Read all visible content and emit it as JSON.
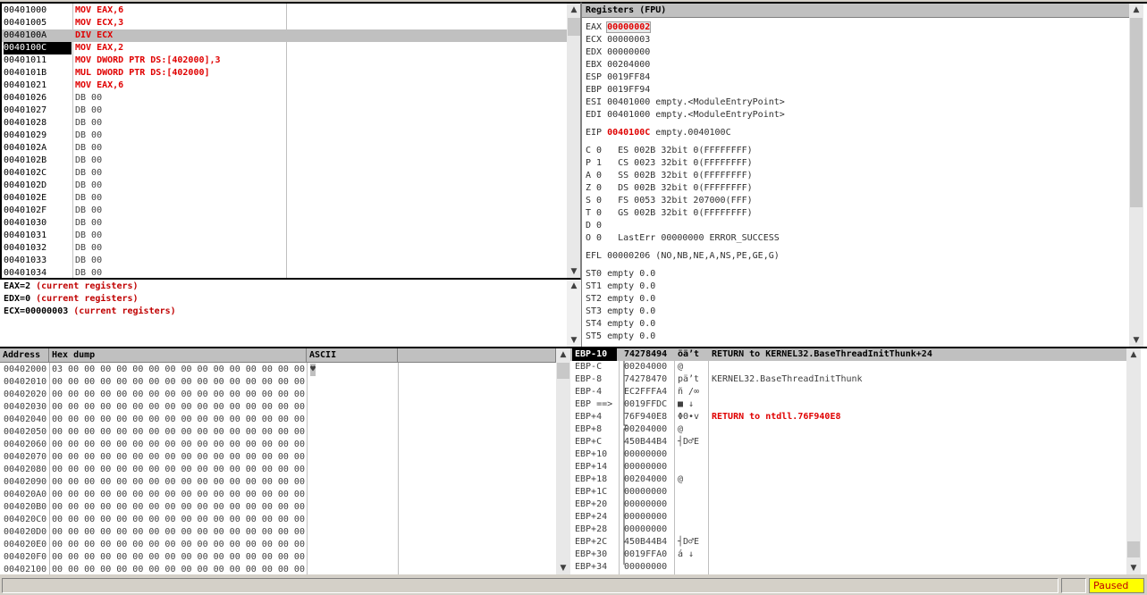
{
  "disassembly": {
    "rows": [
      {
        "addr": "00401000",
        "instr": "MOV EAX,6",
        "style": "red"
      },
      {
        "addr": "00401005",
        "instr": "MOV ECX,3",
        "style": "red"
      },
      {
        "addr": "0040100A",
        "instr": "DIV ECX",
        "style": "red",
        "state": "sel"
      },
      {
        "addr": "0040100C",
        "instr": "MOV EAX,2",
        "style": "red",
        "state": "cur"
      },
      {
        "addr": "00401011",
        "instr": "MOV DWORD PTR DS:[402000],3",
        "style": "red"
      },
      {
        "addr": "0040101B",
        "instr": "MUL DWORD PTR DS:[402000]",
        "style": "red"
      },
      {
        "addr": "00401021",
        "instr": "MOV EAX,6",
        "style": "red"
      },
      {
        "addr": "00401026",
        "instr": "DB 00",
        "style": "gray"
      },
      {
        "addr": "00401027",
        "instr": "DB 00",
        "style": "gray"
      },
      {
        "addr": "00401028",
        "instr": "DB 00",
        "style": "gray"
      },
      {
        "addr": "00401029",
        "instr": "DB 00",
        "style": "gray"
      },
      {
        "addr": "0040102A",
        "instr": "DB 00",
        "style": "gray"
      },
      {
        "addr": "0040102B",
        "instr": "DB 00",
        "style": "gray"
      },
      {
        "addr": "0040102C",
        "instr": "DB 00",
        "style": "gray"
      },
      {
        "addr": "0040102D",
        "instr": "DB 00",
        "style": "gray"
      },
      {
        "addr": "0040102E",
        "instr": "DB 00",
        "style": "gray"
      },
      {
        "addr": "0040102F",
        "instr": "DB 00",
        "style": "gray"
      },
      {
        "addr": "00401030",
        "instr": "DB 00",
        "style": "gray"
      },
      {
        "addr": "00401031",
        "instr": "DB 00",
        "style": "gray"
      },
      {
        "addr": "00401032",
        "instr": "DB 00",
        "style": "gray"
      },
      {
        "addr": "00401033",
        "instr": "DB 00",
        "style": "gray"
      },
      {
        "addr": "00401034",
        "instr": "DB 00",
        "style": "gray"
      }
    ]
  },
  "info": {
    "lines": [
      {
        "name": "EAX=2",
        "note": "(current registers)"
      },
      {
        "name": "EDX=0",
        "note": "(current registers)"
      },
      {
        "name": "ECX=00000003",
        "note": "(current registers)"
      }
    ]
  },
  "registers": {
    "title": "Registers (FPU)",
    "lines": [
      {
        "label": "EAX",
        "value": "00000002",
        "rest": "",
        "highlight": "box"
      },
      {
        "label": "ECX",
        "value": "00000003",
        "rest": ""
      },
      {
        "label": "EDX",
        "value": "00000000",
        "rest": ""
      },
      {
        "label": "EBX",
        "value": "00204000",
        "rest": ""
      },
      {
        "label": "ESP",
        "value": "0019FF84",
        "rest": ""
      },
      {
        "label": "EBP",
        "value": "0019FF94",
        "rest": ""
      },
      {
        "label": "ESI",
        "value": "00401000",
        "rest": "empty.<ModuleEntryPoint>"
      },
      {
        "label": "EDI",
        "value": "00401000",
        "rest": "empty.<ModuleEntryPoint>"
      },
      {
        "gap": true
      },
      {
        "label": "EIP",
        "value": "0040100C",
        "rest": "empty.0040100C",
        "highlight": "red"
      },
      {
        "gap": true
      },
      {
        "label": "C 0",
        "value": "ES 002B",
        "rest": "32bit 0(FFFFFFFF)"
      },
      {
        "label": "P 1",
        "value": "CS 0023",
        "rest": "32bit 0(FFFFFFFF)"
      },
      {
        "label": "A 0",
        "value": "SS 002B",
        "rest": "32bit 0(FFFFFFFF)"
      },
      {
        "label": "Z 0",
        "value": "DS 002B",
        "rest": "32bit 0(FFFFFFFF)"
      },
      {
        "label": "S 0",
        "value": "FS 0053",
        "rest": "32bit 207000(FFF)"
      },
      {
        "label": "T 0",
        "value": "GS 002B",
        "rest": "32bit 0(FFFFFFFF)"
      },
      {
        "label": "D 0",
        "value": "",
        "rest": ""
      },
      {
        "label": "O 0",
        "value": "LastErr",
        "rest": "00000000 ERROR_SUCCESS"
      },
      {
        "gap": true
      },
      {
        "label": "EFL",
        "value": "00000206",
        "rest": "(NO,NB,NE,A,NS,PE,GE,G)"
      },
      {
        "gap": true
      },
      {
        "label": "ST0",
        "value": "empty",
        "rest": "0.0"
      },
      {
        "label": "ST1",
        "value": "empty",
        "rest": "0.0"
      },
      {
        "label": "ST2",
        "value": "empty",
        "rest": "0.0"
      },
      {
        "label": "ST3",
        "value": "empty",
        "rest": "0.0"
      },
      {
        "label": "ST4",
        "value": "empty",
        "rest": "0.0"
      },
      {
        "label": "ST5",
        "value": "empty",
        "rest": "0.0"
      }
    ]
  },
  "dump": {
    "headers": {
      "address": "Address",
      "hex": "Hex dump",
      "ascii": "ASCII"
    },
    "rows": [
      {
        "addr": "00402000",
        "hex": "03 00 00 00 00 00 00 00 00 00 00 00 00 00 00 00",
        "ascii": "♥"
      },
      {
        "addr": "00402010",
        "hex": "00 00 00 00 00 00 00 00 00 00 00 00 00 00 00 00",
        "ascii": ""
      },
      {
        "addr": "00402020",
        "hex": "00 00 00 00 00 00 00 00 00 00 00 00 00 00 00 00",
        "ascii": ""
      },
      {
        "addr": "00402030",
        "hex": "00 00 00 00 00 00 00 00 00 00 00 00 00 00 00 00",
        "ascii": ""
      },
      {
        "addr": "00402040",
        "hex": "00 00 00 00 00 00 00 00 00 00 00 00 00 00 00 00",
        "ascii": ""
      },
      {
        "addr": "00402050",
        "hex": "00 00 00 00 00 00 00 00 00 00 00 00 00 00 00 00",
        "ascii": ""
      },
      {
        "addr": "00402060",
        "hex": "00 00 00 00 00 00 00 00 00 00 00 00 00 00 00 00",
        "ascii": ""
      },
      {
        "addr": "00402070",
        "hex": "00 00 00 00 00 00 00 00 00 00 00 00 00 00 00 00",
        "ascii": ""
      },
      {
        "addr": "00402080",
        "hex": "00 00 00 00 00 00 00 00 00 00 00 00 00 00 00 00",
        "ascii": ""
      },
      {
        "addr": "00402090",
        "hex": "00 00 00 00 00 00 00 00 00 00 00 00 00 00 00 00",
        "ascii": ""
      },
      {
        "addr": "004020A0",
        "hex": "00 00 00 00 00 00 00 00 00 00 00 00 00 00 00 00",
        "ascii": ""
      },
      {
        "addr": "004020B0",
        "hex": "00 00 00 00 00 00 00 00 00 00 00 00 00 00 00 00",
        "ascii": ""
      },
      {
        "addr": "004020C0",
        "hex": "00 00 00 00 00 00 00 00 00 00 00 00 00 00 00 00",
        "ascii": ""
      },
      {
        "addr": "004020D0",
        "hex": "00 00 00 00 00 00 00 00 00 00 00 00 00 00 00 00",
        "ascii": ""
      },
      {
        "addr": "004020E0",
        "hex": "00 00 00 00 00 00 00 00 00 00 00 00 00 00 00 00",
        "ascii": ""
      },
      {
        "addr": "004020F0",
        "hex": "00 00 00 00 00 00 00 00 00 00 00 00 00 00 00 00",
        "ascii": ""
      },
      {
        "addr": "00402100",
        "hex": "00 00 00 00 00 00 00 00 00 00 00 00 00 00 00 00",
        "ascii": ""
      }
    ]
  },
  "stack": {
    "rows": [
      {
        "off": "EBP-10",
        "val": "74278494",
        "asc": "öä’t",
        "cmt": "RETURN to KERNEL32.BaseThreadInitThunk+24",
        "cmtStyle": "bold",
        "state": "top"
      },
      {
        "off": "EBP-C",
        "val": "00204000",
        "asc": "@",
        "cmt": ""
      },
      {
        "off": "EBP-8",
        "val": "74278470",
        "asc": "pä’t",
        "cmt": "KERNEL32.BaseThreadInitThunk",
        "cmtStyle": "normal"
      },
      {
        "off": "EBP-4",
        "val": "EC2FFFA4",
        "asc": "ñ /∞",
        "cmt": ""
      },
      {
        "off": "EBP ==>",
        "val": "0019FFDC",
        "asc": "■ ↓",
        "cmt": ""
      },
      {
        "off": "EBP+4",
        "val": "76F940E8",
        "asc": "ΦΘ•v",
        "cmt": "RETURN to ntdll.76F940E8",
        "cmtStyle": "red"
      },
      {
        "off": "EBP+8",
        "val": "00204000",
        "asc": "@",
        "cmt": ""
      },
      {
        "off": "EBP+C",
        "val": "450B44B4",
        "asc": "┤D♂E",
        "cmt": ""
      },
      {
        "off": "EBP+10",
        "val": "00000000",
        "asc": "",
        "cmt": ""
      },
      {
        "off": "EBP+14",
        "val": "00000000",
        "asc": "",
        "cmt": ""
      },
      {
        "off": "EBP+18",
        "val": "00204000",
        "asc": "@",
        "cmt": ""
      },
      {
        "off": "EBP+1C",
        "val": "00000000",
        "asc": "",
        "cmt": ""
      },
      {
        "off": "EBP+20",
        "val": "00000000",
        "asc": "",
        "cmt": ""
      },
      {
        "off": "EBP+24",
        "val": "00000000",
        "asc": "",
        "cmt": ""
      },
      {
        "off": "EBP+28",
        "val": "00000000",
        "asc": "",
        "cmt": ""
      },
      {
        "off": "EBP+2C",
        "val": "450B44B4",
        "asc": "┤D♂E",
        "cmt": ""
      },
      {
        "off": "EBP+30",
        "val": "0019FFA0",
        "asc": "á ↓",
        "cmt": ""
      },
      {
        "off": "EBP+34",
        "val": "00000000",
        "asc": "",
        "cmt": ""
      }
    ]
  },
  "status": {
    "state": "Paused"
  },
  "colors": {
    "accent_red": "#e00000",
    "status_bg": "#ffff00",
    "selection": "#c0c0c0"
  }
}
